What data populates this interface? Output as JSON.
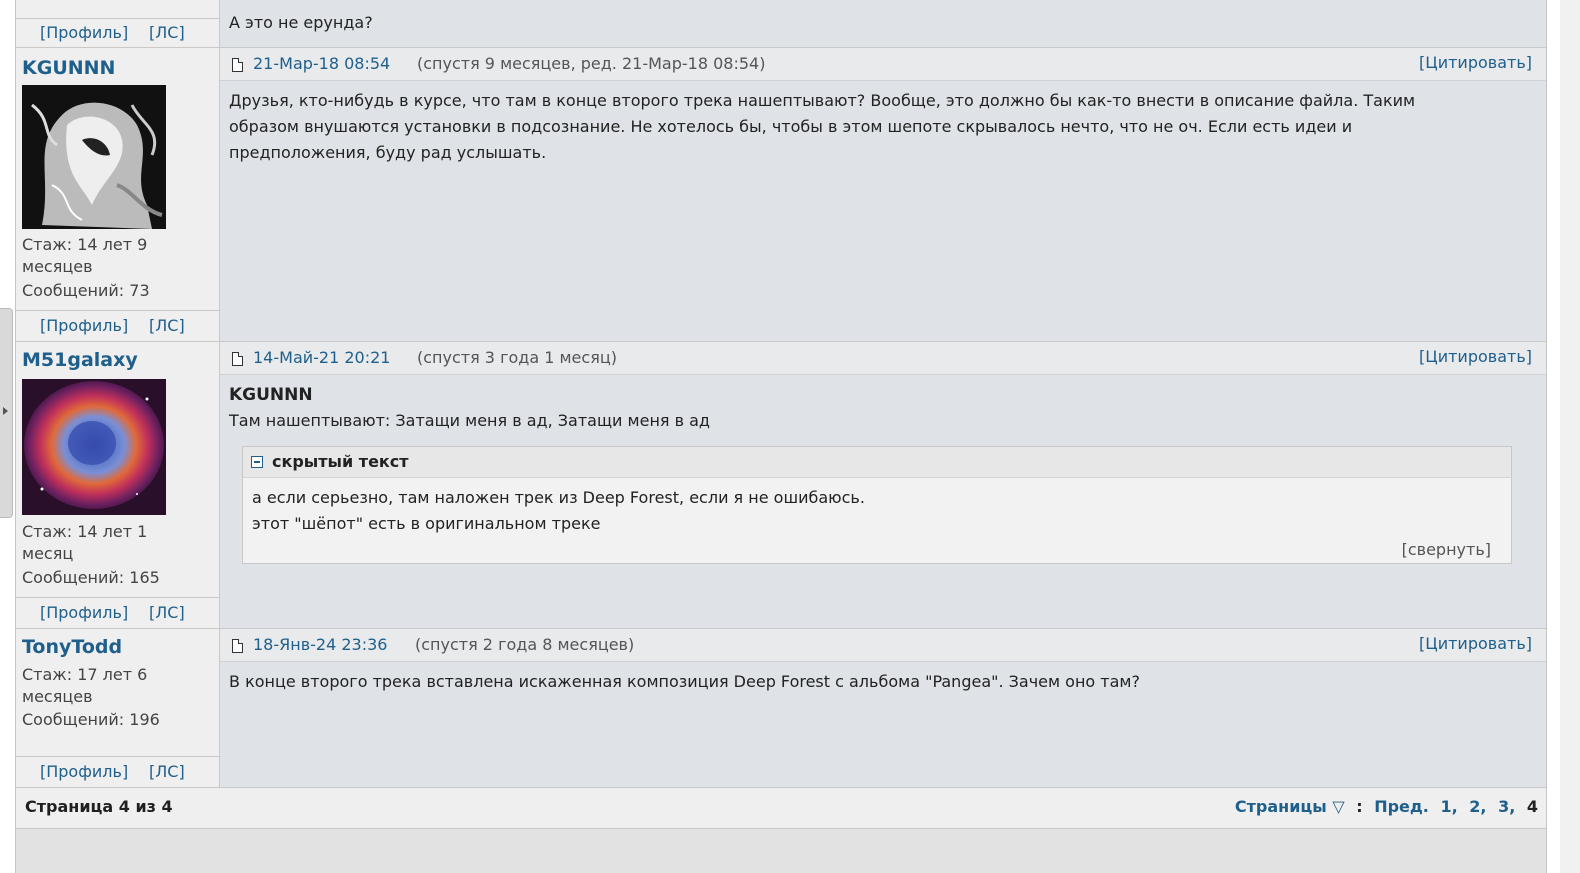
{
  "top_post": {
    "body": "А это не ерунда?",
    "profile": "[Профиль]",
    "pm": "[ЛС]"
  },
  "posts": [
    {
      "nick": "KGUNNN",
      "tenure_label": "Стаж:",
      "tenure_value": "14 лет 9",
      "tenure_value2": "месяцев",
      "messages_label": "Сообщений:",
      "messages_value": "73",
      "profile": "[Профиль]",
      "pm": "[ЛС]",
      "date": "21-Мар-18 08:54",
      "since": "(спустя 9 месяцев, ред. 21-Мар-18 08:54)",
      "quote": "[Цитировать]",
      "body_lines": [
        "Друзья, кто-нибудь в курсе, что там в конце второго трека нашептывают? Вообще, это должно бы как-то внести в описание файла. Таким",
        "образом внушаются установки в подсознание. Не хотелось бы, чтобы в этом шепоте скрывалось нечто, что не оч. Если есть идеи и",
        "предположения, буду рад услышать."
      ]
    },
    {
      "nick": "M51galaxy",
      "tenure_label": "Стаж:",
      "tenure_value": "14 лет 1",
      "tenure_value2": "месяц",
      "messages_label": "Сообщений:",
      "messages_value": "165",
      "profile": "[Профиль]",
      "pm": "[ЛС]",
      "date": "14-Май-21 20:21",
      "since": "(спустя 3 года 1 месяц)",
      "quote": "[Цитировать]",
      "reply_to": "KGUNNN",
      "body_line": "Там нашептывают: Затащи меня в ад, Затащи меня в ад",
      "hidden_title": "скрытый текст",
      "hidden_lines": [
        "а если серьезно, там наложен трек из Deep Forest, если я не ошибаюсь.",
        "этот \"шёпот\" есть в оригинальном треке"
      ],
      "collapse": "[свернуть]"
    },
    {
      "nick": "TonyTodd",
      "tenure_label": "Стаж:",
      "tenure_value": "17 лет 6",
      "tenure_value2": "месяцев",
      "messages_label": "Сообщений:",
      "messages_value": "196",
      "profile": "[Профиль]",
      "pm": "[ЛС]",
      "date": "18-Янв-24 23:36",
      "since": "(спустя 2 года 8 месяцев)",
      "quote": "[Цитировать]",
      "body_line": "В конце второго трека вставлена искаженная композиция Deep Forest с альбома \"Pangea\". Зачем оно там?"
    }
  ],
  "footer": {
    "page_info": "Страница 4 из 4",
    "pages_label": "Страницы",
    "prev": "Пред.",
    "pages": [
      "1,",
      "2,",
      "3,",
      "4"
    ]
  }
}
